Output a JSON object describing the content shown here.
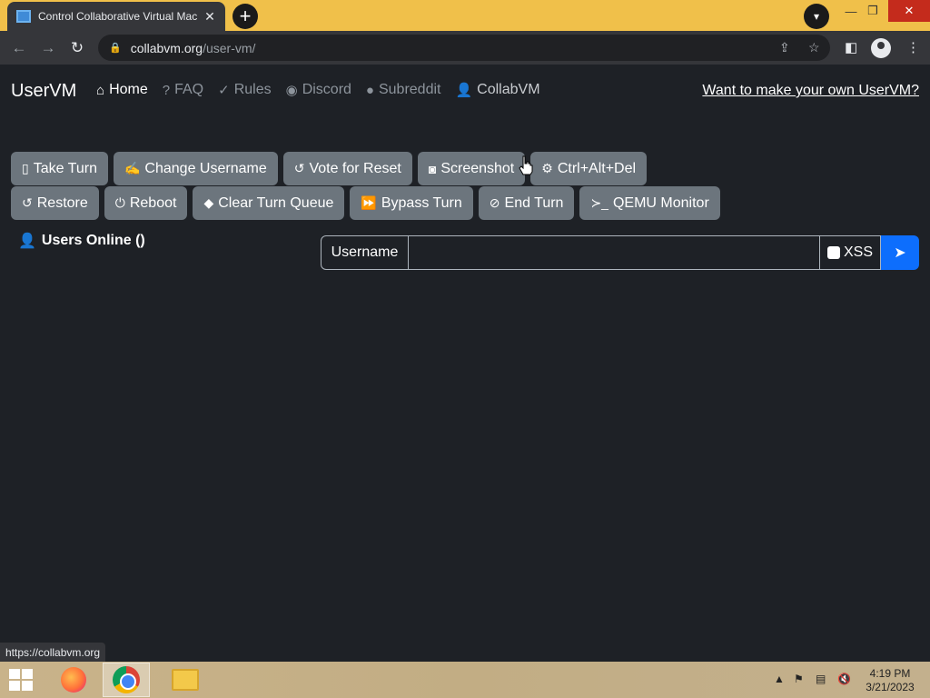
{
  "browser": {
    "tab_title": "Control Collaborative Virtual Mac",
    "url_host": "collabvm.org",
    "url_path": "/user-vm/",
    "status_url": "https://collabvm.org"
  },
  "site": {
    "brand": "UserVM",
    "nav": [
      {
        "label": "Home",
        "icon": "home-icon"
      },
      {
        "label": "FAQ",
        "icon": "question-circle-icon"
      },
      {
        "label": "Rules",
        "icon": "clipboard-check-icon"
      },
      {
        "label": "Discord",
        "icon": "discord-icon"
      },
      {
        "label": "Subreddit",
        "icon": "reddit-icon"
      },
      {
        "label": "CollabVM",
        "icon": "person-icon"
      }
    ],
    "own_link": "Want to make your own UserVM?"
  },
  "actions": {
    "row1": [
      {
        "label": "Take Turn",
        "icon": "mouse-icon"
      },
      {
        "label": "Change Username",
        "icon": "signature-icon"
      },
      {
        "label": "Vote for Reset",
        "icon": "rotate-left-icon"
      },
      {
        "label": "Screenshot",
        "icon": "camera-icon"
      },
      {
        "label": "Ctrl+Alt+Del",
        "icon": "gear-icon"
      }
    ],
    "row2": [
      {
        "label": "Restore",
        "icon": "rotate-left-icon"
      },
      {
        "label": "Reboot",
        "icon": "power-icon"
      },
      {
        "label": "Clear Turn Queue",
        "icon": "eraser-icon"
      },
      {
        "label": "Bypass Turn",
        "icon": "forward-icon"
      },
      {
        "label": "End Turn",
        "icon": "ban-icon"
      },
      {
        "label": "QEMU Monitor",
        "icon": "terminal-icon"
      }
    ]
  },
  "users": {
    "label": "Users Online ()"
  },
  "chat": {
    "username_label": "Username",
    "input_value": "",
    "xss_label": "XSS"
  },
  "taskbar": {
    "time": "4:19 PM",
    "date": "3/21/2023"
  }
}
